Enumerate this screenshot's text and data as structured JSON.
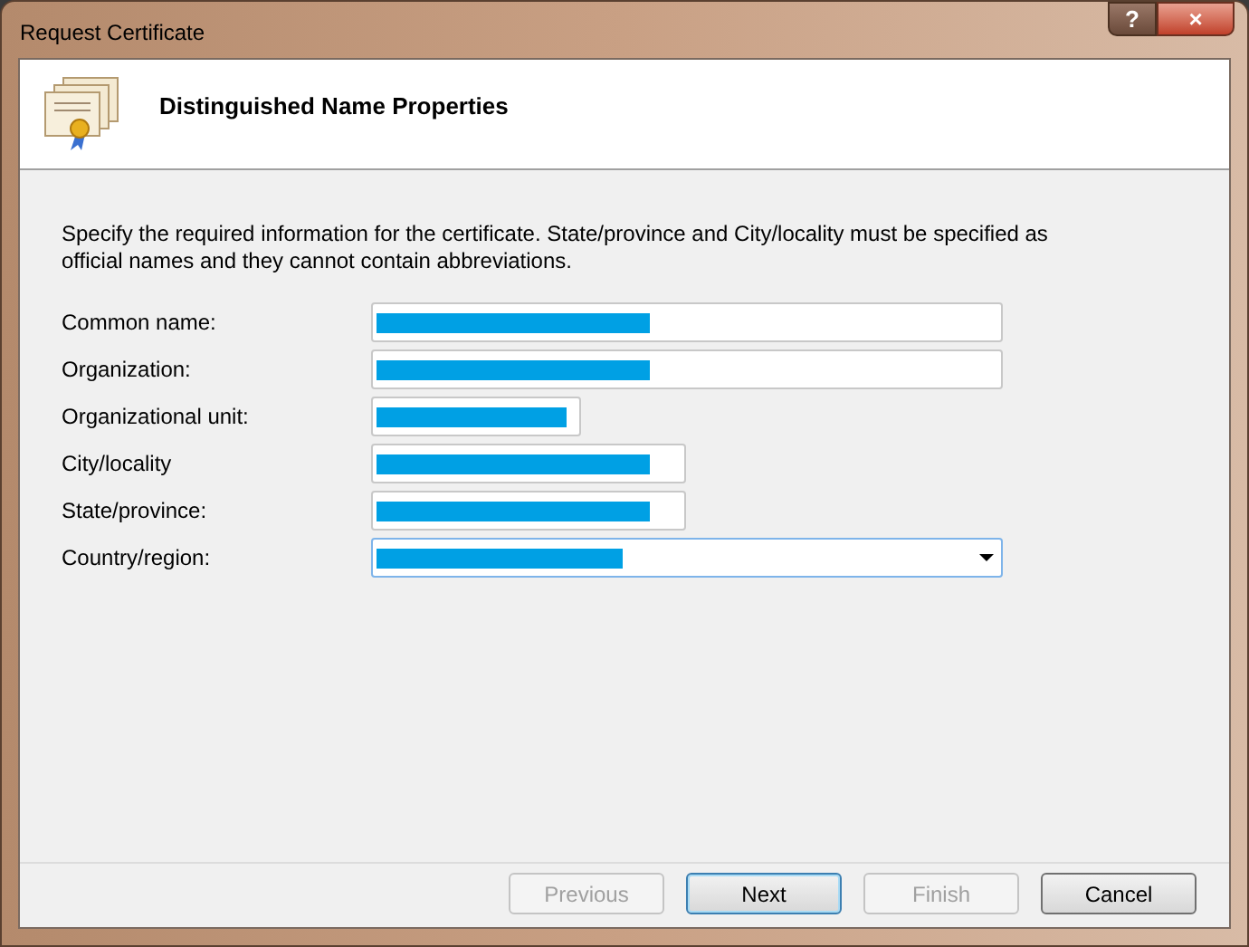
{
  "window": {
    "title": "Request Certificate",
    "buttons": [
      "?",
      "×"
    ]
  },
  "header": {
    "title": "Distinguished Name Properties"
  },
  "instructions": "Specify the required information for the certificate. State/province and City/locality must be specified as official names and they cannot contain abbreviations.",
  "fields": [
    {
      "label": "Common name:",
      "kind": "wide"
    },
    {
      "label": "Organization:",
      "kind": "wide"
    },
    {
      "label": "Organizational unit:",
      "kind": "narrow"
    },
    {
      "label": "City/locality",
      "kind": "medium"
    },
    {
      "label": "State/province:",
      "kind": "medium"
    },
    {
      "label": "Country/region:",
      "kind": "dropdown"
    }
  ],
  "buttons": [
    {
      "label": "Previous",
      "disabled": true,
      "default": false
    },
    {
      "label": "Next",
      "disabled": false,
      "default": true
    },
    {
      "label": "Finish",
      "disabled": true,
      "default": false
    },
    {
      "label": "Cancel",
      "disabled": false,
      "default": false
    }
  ]
}
